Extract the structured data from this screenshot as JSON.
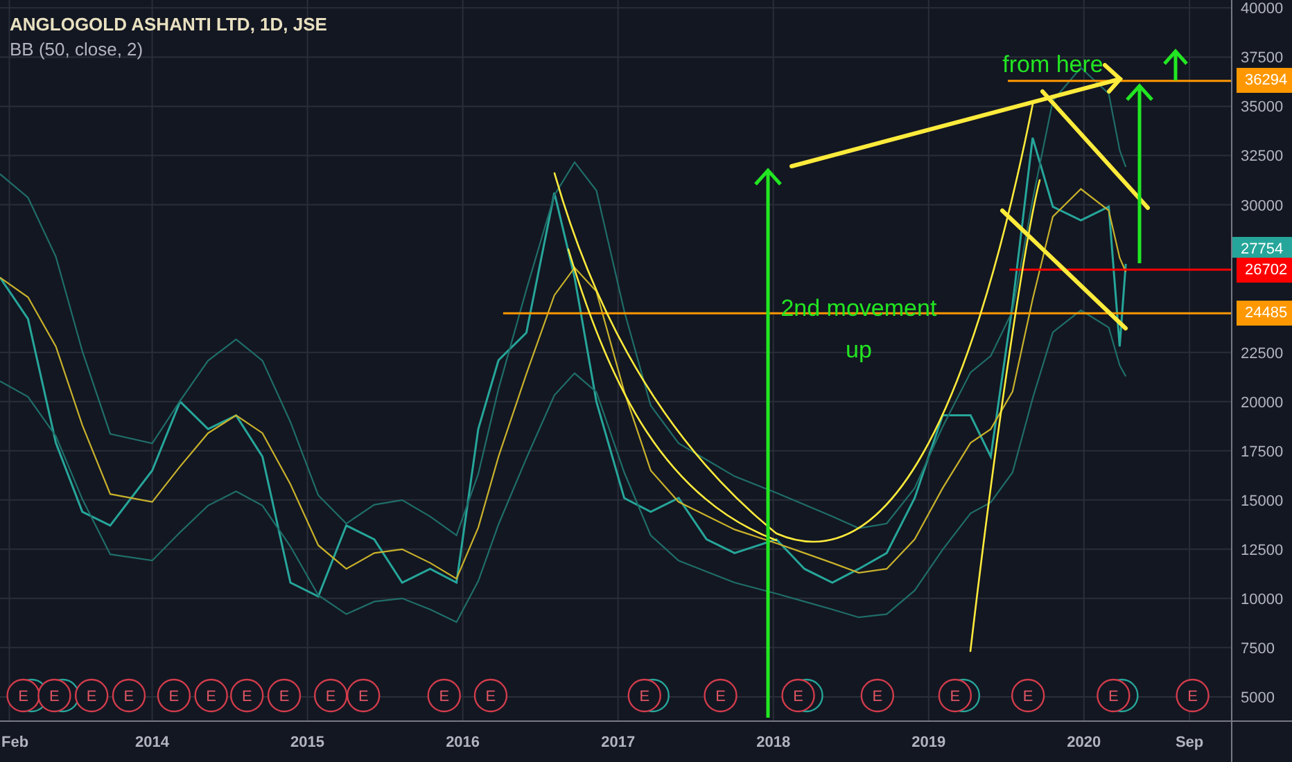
{
  "indicator": "BB (50, close, 2)",
  "chart_data": {
    "type": "line",
    "title": "ANGLOGOLD ASHANTI LTD, 1D, JSE",
    "x": [
      2013.02,
      2013.2,
      2013.38,
      2013.55,
      2013.73,
      2014.0,
      2014.18,
      2014.36,
      2014.54,
      2014.71,
      2014.89,
      2015.07,
      2015.25,
      2015.43,
      2015.61,
      2015.79,
      2015.96,
      2016.1,
      2016.23,
      2016.41,
      2016.59,
      2016.72,
      2016.86,
      2017.04,
      2017.21,
      2017.39,
      2017.57,
      2017.75,
      2018.02,
      2018.2,
      2018.38,
      2018.55,
      2018.73,
      2018.91,
      2019.09,
      2019.27,
      2019.4,
      2019.54,
      2019.67,
      2019.8,
      2019.98,
      2020.16,
      2020.23,
      2020.27
    ],
    "series": [
      {
        "color": "#26a69a",
        "values": [
          26300,
          24200,
          17900,
          14400,
          13700,
          16500,
          20000,
          18600,
          19300,
          17200,
          10800,
          10100,
          13700,
          13000,
          10800,
          11500,
          10800,
          18600,
          22100,
          23500,
          30600,
          26300,
          20000,
          15100,
          14400,
          15100,
          13000,
          12300,
          13000,
          11500,
          10800,
          11500,
          12300,
          15100,
          19300,
          19300,
          17200,
          24900,
          33400,
          29900,
          29200,
          29900,
          22800,
          27000
        ]
      },
      {
        "color": "#1f6e69",
        "values": [
          31560,
          30360,
          27360,
          22560,
          18360,
          17880,
          20040,
          22080,
          23160,
          22080,
          18960,
          15240,
          13800,
          14760,
          15000,
          14160,
          13200,
          16320,
          20640,
          25680,
          30480,
          32160,
          30720,
          24600,
          19800,
          17880,
          17040,
          16200,
          15360,
          14760,
          14160,
          13560,
          13800,
          15600,
          18720,
          21480,
          22320,
          24600,
          30240,
          35280,
          36960,
          35640,
          32760,
          31920
        ]
      },
      {
        "color": "#c9b22b",
        "values": [
          26300,
          25300,
          22800,
          18800,
          15300,
          14900,
          16700,
          18400,
          19300,
          18400,
          15800,
          12700,
          11500,
          12300,
          12500,
          11800,
          11000,
          13600,
          17200,
          21400,
          25400,
          26800,
          25600,
          20500,
          16500,
          14900,
          14200,
          13500,
          12800,
          12300,
          11800,
          11300,
          11500,
          13000,
          15600,
          17900,
          18600,
          20500,
          25200,
          29400,
          30800,
          29700,
          27300,
          26600
        ]
      },
      {
        "color": "#1f6e69",
        "values": [
          21040,
          20240,
          18240,
          15040,
          12240,
          11920,
          13360,
          14720,
          15440,
          14720,
          12640,
          10160,
          9200,
          9840,
          10000,
          9440,
          8800,
          10880,
          13760,
          17120,
          20320,
          21440,
          20480,
          16400,
          13200,
          11920,
          11360,
          10800,
          10240,
          9840,
          9440,
          9040,
          9200,
          10400,
          12480,
          14320,
          14880,
          16400,
          20160,
          23520,
          24640,
          23760,
          21840,
          21280
        ]
      }
    ],
    "xlim": [
      2013.02,
      2021.34
    ],
    "ylim": [
      3800,
      40400
    ],
    "grid": true,
    "xticks": [
      {
        "value": 2013.08,
        "label": "Feb"
      },
      {
        "value": 2014,
        "label": "2014"
      },
      {
        "value": 2015,
        "label": "2015"
      },
      {
        "value": 2016,
        "label": "2016"
      },
      {
        "value": 2017,
        "label": "2017"
      },
      {
        "value": 2018,
        "label": "2018"
      },
      {
        "value": 2019,
        "label": "2019"
      },
      {
        "value": 2020,
        "label": "2020"
      },
      {
        "value": 2020.68,
        "label": "Sep"
      }
    ],
    "yticks": [
      5000,
      7500,
      10000,
      12500,
      15000,
      17500,
      20000,
      22500,
      30000,
      32500,
      35000,
      37500,
      40000
    ],
    "annotations": [
      {
        "text": "from here"
      },
      {
        "text": "2nd movement up"
      }
    ]
  },
  "price_lines": [
    {
      "label": "36294",
      "color": "#ff9800",
      "line": true
    },
    {
      "label": "27754",
      "color": "#26a69a",
      "line": false
    },
    {
      "label": "26702",
      "color": "#ff0000",
      "line": true
    },
    {
      "label": "24485",
      "color": "#ff9800",
      "line": true
    }
  ],
  "earnings": [
    {
      "label": "E",
      "dividend": true
    },
    {
      "label": "E",
      "dividend": true
    },
    {
      "label": "E",
      "dividend": false
    },
    {
      "label": "E",
      "dividend": false
    },
    {
      "label": "E",
      "dividend": false
    },
    {
      "label": "E",
      "dividend": false
    },
    {
      "label": "E",
      "dividend": false
    },
    {
      "label": "E",
      "dividend": false
    },
    {
      "label": "E",
      "dividend": false
    },
    {
      "label": "E",
      "dividend": false
    },
    {
      "label": "E",
      "dividend": false
    },
    {
      "label": "E",
      "dividend": false
    },
    {
      "label": "E",
      "dividend": true
    },
    {
      "label": "E",
      "dividend": false
    },
    {
      "label": "E",
      "dividend": true
    },
    {
      "label": "E",
      "dividend": false
    },
    {
      "label": "E",
      "dividend": true
    },
    {
      "label": "E",
      "dividend": false
    },
    {
      "label": "E",
      "dividend": true
    },
    {
      "label": "E",
      "dividend": false
    }
  ]
}
